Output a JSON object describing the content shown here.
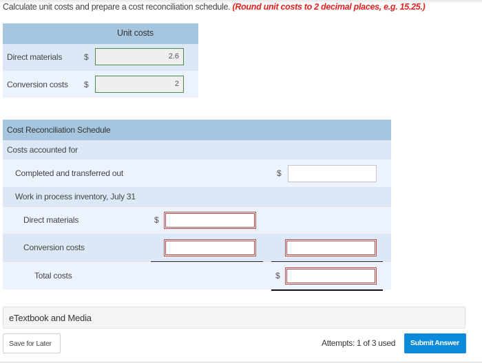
{
  "instructions": {
    "text": "Calculate unit costs and prepare a cost reconciliation schedule.",
    "note": "(Round unit costs to 2 decimal places, e.g. 15.25.)"
  },
  "unit_costs": {
    "header": "Unit costs",
    "rows": [
      {
        "label": "Direct materials",
        "currency": "$",
        "value": "2.6"
      },
      {
        "label": "Conversion costs",
        "currency": "$",
        "value": "2"
      }
    ]
  },
  "reconciliation": {
    "title": "Cost Reconciliation Schedule",
    "section": "Costs accounted for",
    "completed": {
      "label": "Completed and transferred out",
      "currency": "$",
      "value": ""
    },
    "wip": {
      "label": "Work in process inventory, July 31"
    },
    "wip_dm": {
      "label": "Direct materials",
      "currency": "$",
      "value": ""
    },
    "wip_cc": {
      "label": "Conversion costs",
      "value": "",
      "total_value": ""
    },
    "total": {
      "label": "Total costs",
      "currency": "$",
      "value": ""
    }
  },
  "etextbook": {
    "label": "eTextbook and Media"
  },
  "footer": {
    "save_label": "Save for Later",
    "attempts": "Attempts: 1 of 3 used",
    "submit_label": "Submit Answer"
  },
  "colors": {
    "header_bg": "#a5c6de",
    "row_dark": "#dce8f6",
    "row_light": "#ecf3fd",
    "submit": "#0a8ad8",
    "error_border": "#b94a48",
    "correct_border": "#4b8a4b",
    "note_red": "#e1221c"
  }
}
